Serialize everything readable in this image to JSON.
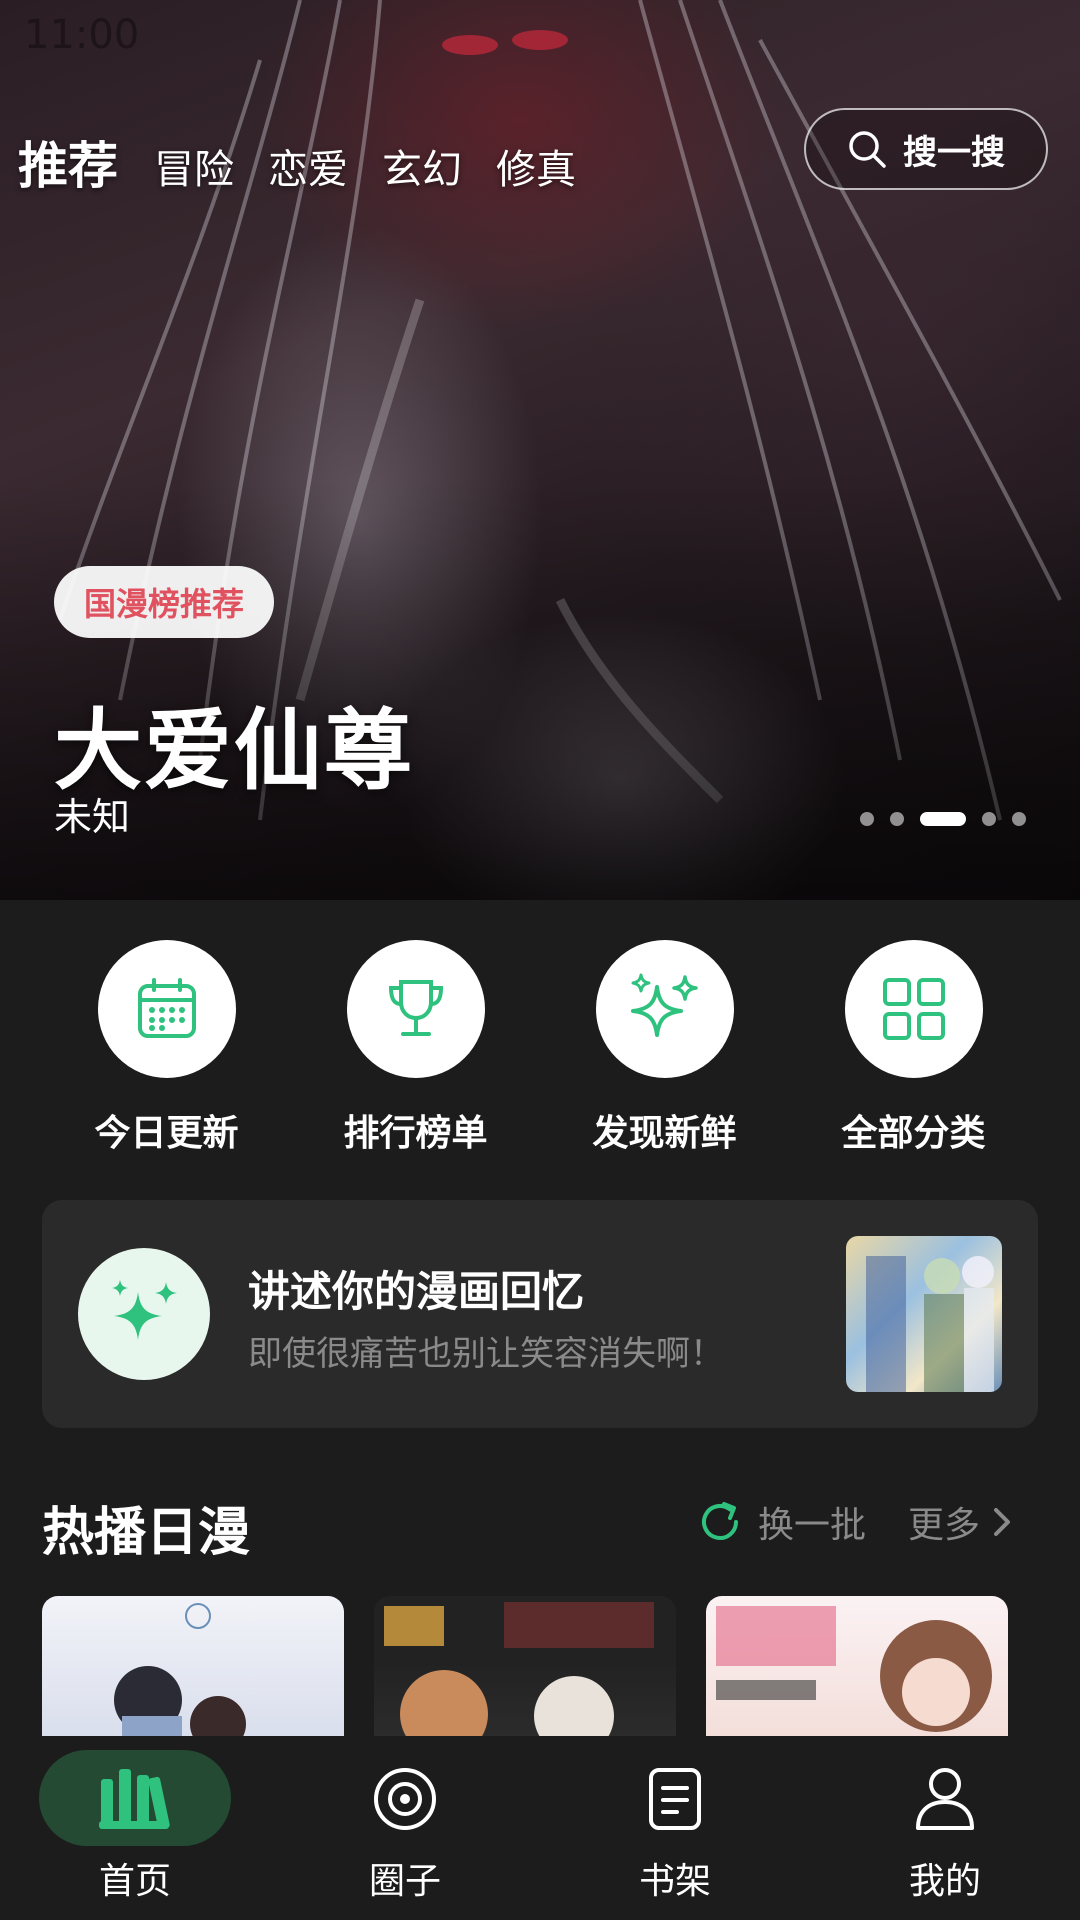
{
  "status_bar": {
    "time": "11:00"
  },
  "top_nav": {
    "tabs": [
      "推荐",
      "冒险",
      "恋爱",
      "玄幻",
      "修真"
    ],
    "active_tab": "推荐",
    "search_label": "搜一搜"
  },
  "banner": {
    "tag": "国漫榜推荐",
    "title": "大爱仙尊",
    "author": "未知",
    "page_count": 5,
    "active_page": 3
  },
  "quick_actions": [
    {
      "label": "今日更新",
      "icon": "calendar-icon"
    },
    {
      "label": "排行榜单",
      "icon": "trophy-icon"
    },
    {
      "label": "发现新鲜",
      "icon": "sparkles-icon"
    },
    {
      "label": "全部分类",
      "icon": "grid-icon"
    }
  ],
  "memory_card": {
    "title": "讲述你的漫画回忆",
    "subtitle": "即使很痛苦也别让笑容消失啊！",
    "icon": "sparkles-icon"
  },
  "hot_section": {
    "title": "热播日漫",
    "refresh_label": "换一批",
    "more_label": "更多"
  },
  "bottom_tabs": [
    {
      "label": "首页",
      "icon": "bookshelf-icon",
      "active": true
    },
    {
      "label": "圈子",
      "icon": "target-icon",
      "active": false
    },
    {
      "label": "书架",
      "icon": "document-icon",
      "active": false
    },
    {
      "label": "我的",
      "icon": "user-icon",
      "active": false
    }
  ],
  "colors": {
    "accent_green": "#2ec27e",
    "tag_red": "#e0525f",
    "background": "#1c1c1c",
    "card": "#2a2a2a"
  }
}
